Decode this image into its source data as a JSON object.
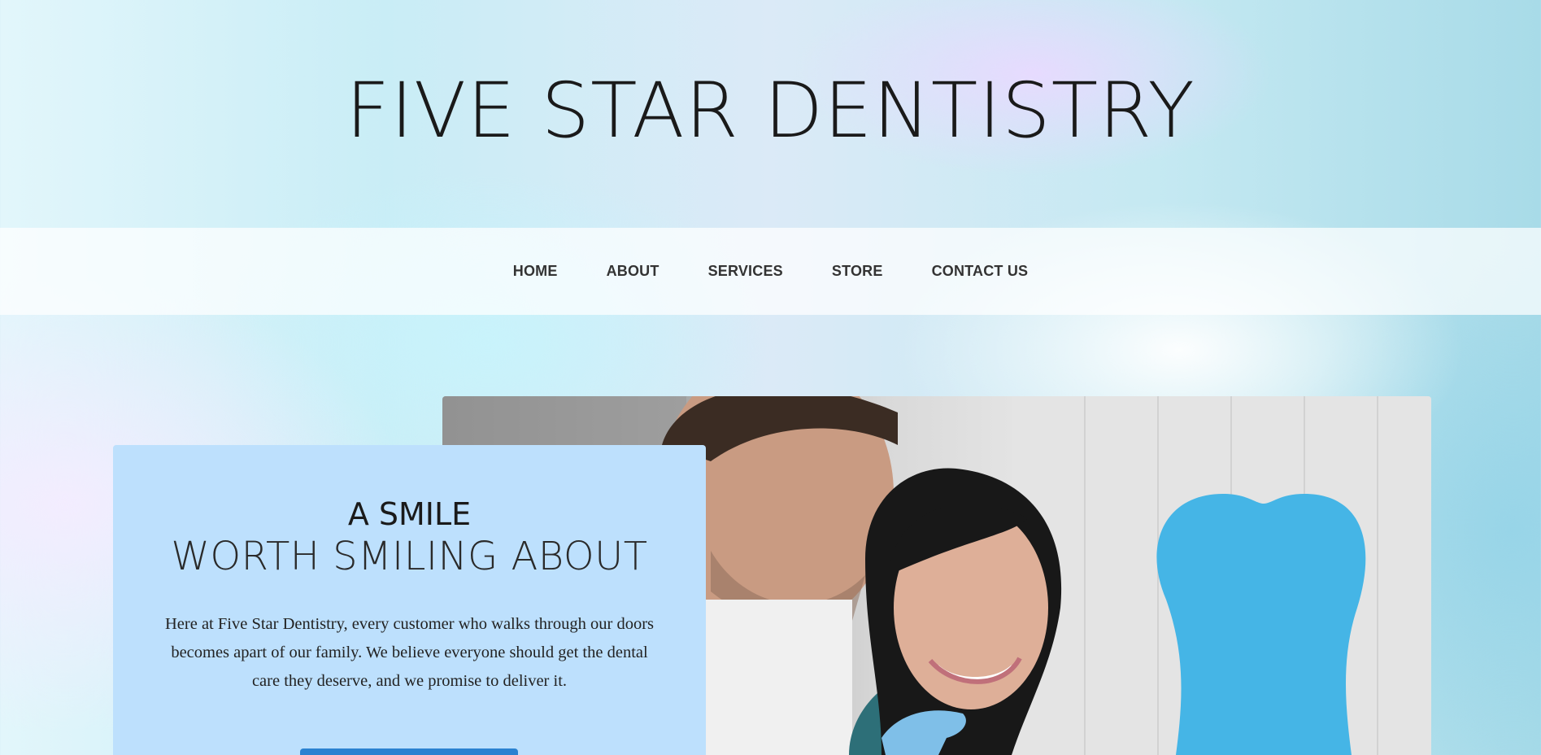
{
  "site": {
    "title": "FIVE STAR DENTISTRY"
  },
  "nav": {
    "items": [
      {
        "label": "HOME"
      },
      {
        "label": "ABOUT"
      },
      {
        "label": "SERVICES"
      },
      {
        "label": "STORE"
      },
      {
        "label": "CONTACT US"
      }
    ]
  },
  "hero": {
    "heading_line1": "A SMILE",
    "heading_line2": "WORTH SMILING ABOUT",
    "body": "Here at Five Star Dentistry, every customer who walks through our doors becomes apart of our family. We believe everyone should get the dental care they deserve, and we promise to deliver it.",
    "button_color": "#2b82d1",
    "card_color": "#bde0fd"
  },
  "photo": {
    "icon": "dentist-patient-photo"
  }
}
